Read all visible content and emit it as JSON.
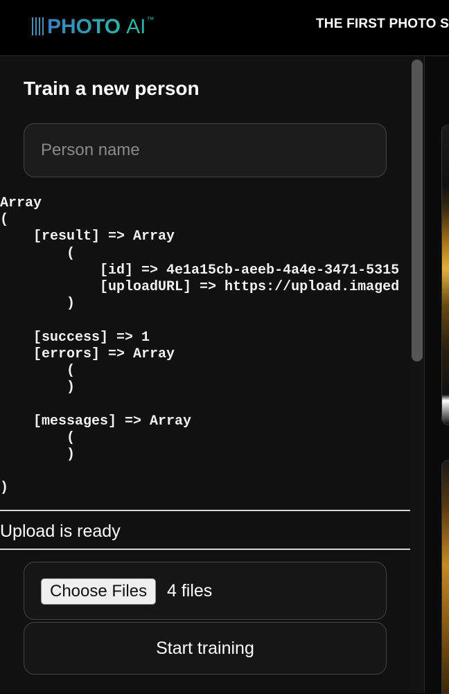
{
  "header": {
    "logo_photo": "PHOTO",
    "logo_ai": "AI",
    "logo_tm": "™",
    "tagline": "THE FIRST PHOTO S"
  },
  "form": {
    "title": "Train a new person",
    "name_placeholder": "Person name",
    "name_value": ""
  },
  "response_dump": "Array\n(\n    [result] => Array\n        (\n            [id] => 4e1a15cb-aeeb-4a4e-3471-5315\n            [uploadURL] => https://upload.imaged\n        )\n\n    [success] => 1\n    [errors] => Array\n        (\n        )\n\n    [messages] => Array\n        (\n        )\n\n)",
  "status": {
    "text": "Upload is ready"
  },
  "upload": {
    "choose_label": "Choose Files",
    "file_count": "4 files"
  },
  "actions": {
    "start_training_label": "Start training"
  },
  "colors": {
    "background": "#0b0b0b",
    "panel": "#111111",
    "logo_gradient_start": "#3a7fc0",
    "logo_gradient_end": "#2bb3a8"
  }
}
